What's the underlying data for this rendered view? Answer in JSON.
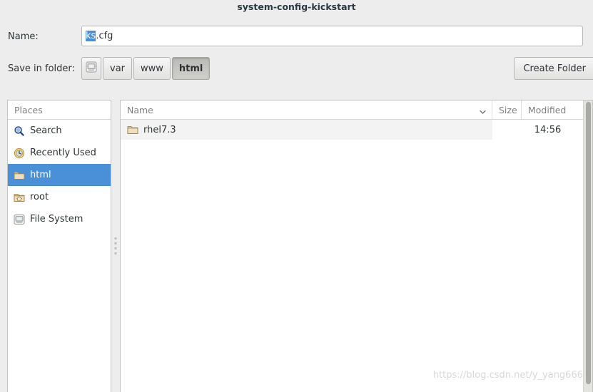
{
  "window": {
    "title": "system-config-kickstart"
  },
  "name_field": {
    "label": "Name:",
    "selected_text": "ks",
    "rest_text": ".cfg",
    "full_value": "ks.cfg",
    "placeholder": "Name"
  },
  "location": {
    "label": "Save in folder:",
    "breadcrumbs": [
      {
        "label": "",
        "icon": "drive-icon",
        "active": false
      },
      {
        "label": "var",
        "icon": "",
        "active": false
      },
      {
        "label": "www",
        "icon": "",
        "active": false
      },
      {
        "label": "html",
        "icon": "",
        "active": true
      }
    ],
    "create_folder_label": "Create Folder"
  },
  "sidebar": {
    "header": "Places",
    "items": [
      {
        "label": "Search",
        "icon": "search-icon",
        "selected": false
      },
      {
        "label": "Recently Used",
        "icon": "clock-icon",
        "selected": false
      },
      {
        "label": "html",
        "icon": "folder-icon",
        "selected": true
      },
      {
        "label": "root",
        "icon": "home-folder-icon",
        "selected": false
      },
      {
        "label": "File System",
        "icon": "drive-icon",
        "selected": false
      }
    ]
  },
  "file_list": {
    "columns": [
      "Name",
      "Size",
      "Modified"
    ],
    "sort_column": "Name",
    "sort_direction": "descending",
    "rows": [
      {
        "name": "rhel7.3",
        "size": "",
        "modified": "14:56",
        "icon": "folder-icon"
      }
    ]
  },
  "watermark": {
    "text": "https://blog.csdn.net/y_yang666"
  },
  "colors": {
    "selection_blue": "#4a90d9",
    "background": "#ededed",
    "panel_white": "#ffffff",
    "row_stripe": "#f3f3f3",
    "text": "#2e3436",
    "muted_text": "#808080",
    "folder_tan": "#c8ab70"
  }
}
